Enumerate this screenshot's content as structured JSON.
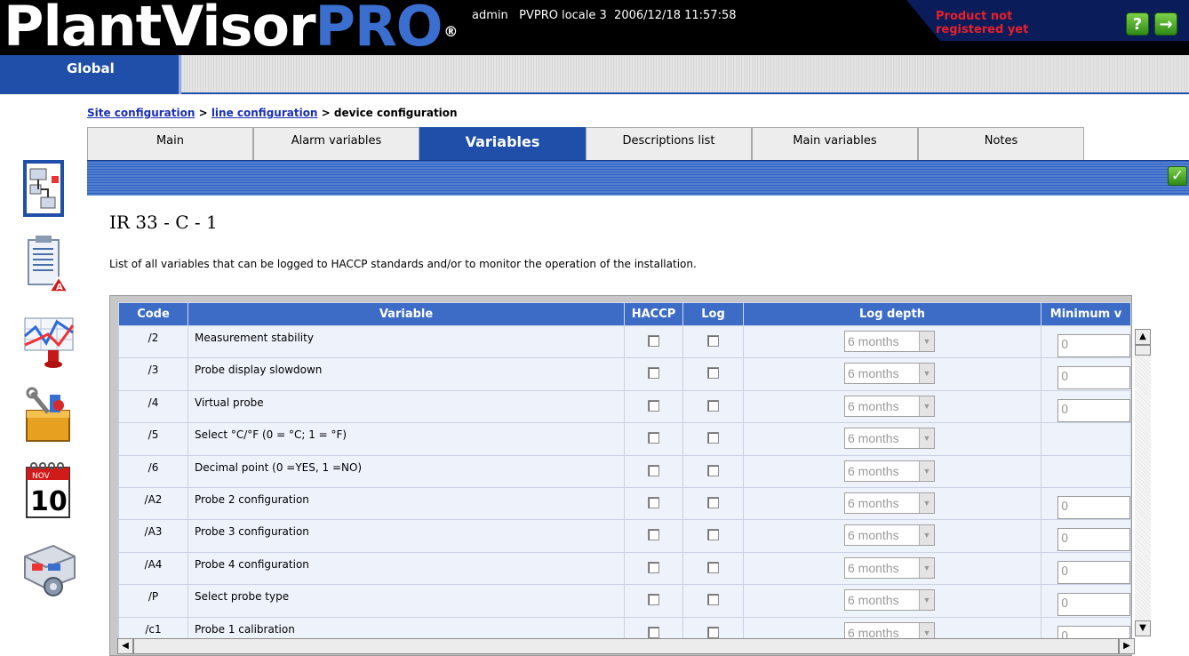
{
  "app": {
    "logo_main": "PlantVisor",
    "logo_pro": "PRO",
    "logo_reg": "®",
    "user_info": "admin   PVPRO locale 3  2006/12/18 11:57:58",
    "registration_warning": "Product not registered yet",
    "help_button": "?",
    "logout_button": "→"
  },
  "global_tab": "Global",
  "breadcrumb": {
    "site_configuration": "Site configuration",
    "sep1": " > ",
    "line_configuration": "line configuration",
    "sep2": " > ",
    "current": "device configuration"
  },
  "tabs": [
    {
      "label": "Main"
    },
    {
      "label": "Alarm variables"
    },
    {
      "label": "Variables"
    },
    {
      "label": "Descriptions list"
    },
    {
      "label": "Main variables"
    },
    {
      "label": "Notes"
    }
  ],
  "active_tab": "Variables",
  "save_button": "✓",
  "device_title": "IR 33 - C - 1",
  "description": "List of all variables that can be logged to HACCP standards and/or to monitor the operation of the installation.",
  "table": {
    "headers": {
      "code": "Code",
      "variable": "Variable",
      "haccp": "HACCP",
      "log": "Log",
      "log_depth": "Log depth",
      "minimum": "Minimum v"
    },
    "rows": [
      {
        "code": "/2",
        "variable": "Measurement stability",
        "haccp": false,
        "log": false,
        "log_depth": "6 months",
        "minimum": "0"
      },
      {
        "code": "/3",
        "variable": "Probe display slowdown",
        "haccp": false,
        "log": false,
        "log_depth": "6 months",
        "minimum": "0"
      },
      {
        "code": "/4",
        "variable": "Virtual probe",
        "haccp": false,
        "log": false,
        "log_depth": "6 months",
        "minimum": "0"
      },
      {
        "code": "/5",
        "variable": "Select °C/°F (0 = °C; 1 = °F)",
        "haccp": false,
        "log": false,
        "log_depth": "6 months",
        "minimum": null
      },
      {
        "code": "/6",
        "variable": "Decimal point (0 =YES, 1 =NO)",
        "haccp": false,
        "log": false,
        "log_depth": "6 months",
        "minimum": null
      },
      {
        "code": "/A2",
        "variable": "Probe 2 configuration",
        "haccp": false,
        "log": false,
        "log_depth": "6 months",
        "minimum": "0"
      },
      {
        "code": "/A3",
        "variable": "Probe 3 configuration",
        "haccp": false,
        "log": false,
        "log_depth": "6 months",
        "minimum": "0"
      },
      {
        "code": "/A4",
        "variable": "Probe 4 configuration",
        "haccp": false,
        "log": false,
        "log_depth": "6 months",
        "minimum": "0"
      },
      {
        "code": "/P",
        "variable": "Select probe type",
        "haccp": false,
        "log": false,
        "log_depth": "6 months",
        "minimum": "0"
      },
      {
        "code": "/c1",
        "variable": "Probe 1 calibration",
        "haccp": false,
        "log": false,
        "log_depth": "6 months",
        "minimum": "0"
      }
    ]
  },
  "scroll": {
    "up": "▲",
    "down": "▼",
    "left": "◀",
    "right": "▶"
  },
  "side_icons": [
    "site-config-icon",
    "alarm-report-icon",
    "graph-icon",
    "tools-icon",
    "calendar-icon",
    "plant-layout-icon"
  ],
  "calendar_icon": {
    "month": "NOV",
    "day": "10"
  },
  "colors": {
    "header_blue": "#1f4fa8",
    "table_header": "#3d6cc6",
    "warning_red": "#e8202a",
    "pro_blue": "#3a6fd0"
  }
}
